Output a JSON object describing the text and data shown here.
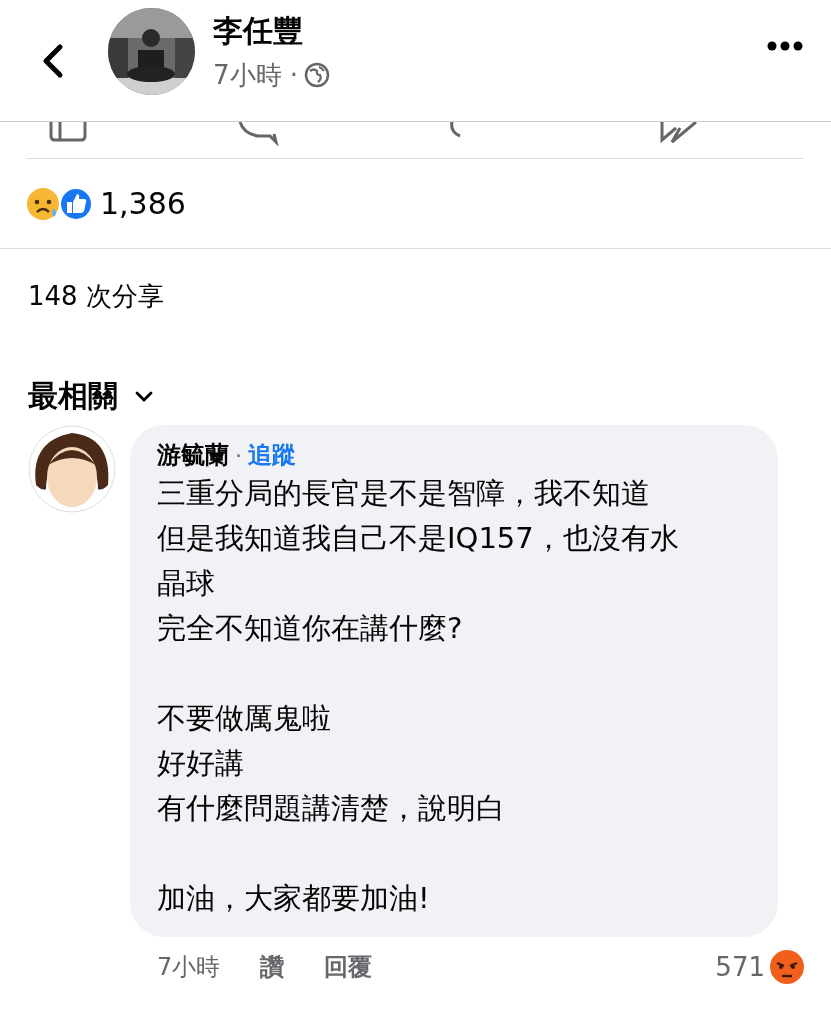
{
  "header": {
    "author": "李任豐",
    "time": "7小時 ·"
  },
  "reactions": {
    "count": "1,386"
  },
  "shares": "148 次分享",
  "sort": {
    "label": "最相關"
  },
  "comment": {
    "author": "游毓蘭",
    "separator": "·",
    "follow": "追蹤",
    "paragraphs": [
      [
        "三重分局的長官是不是智障，我不知道",
        "但是我知道我自己不是IQ157，也沒有水",
        "晶球",
        "完全不知道你在講什麼?"
      ],
      [
        "不要做厲鬼啦",
        "好好講",
        "有什麼問題講清楚，說明白"
      ],
      [
        "加油，大家都要加油!"
      ]
    ],
    "time": "7小時",
    "like": "讚",
    "reply": "回覆",
    "reaction_count": "571"
  }
}
